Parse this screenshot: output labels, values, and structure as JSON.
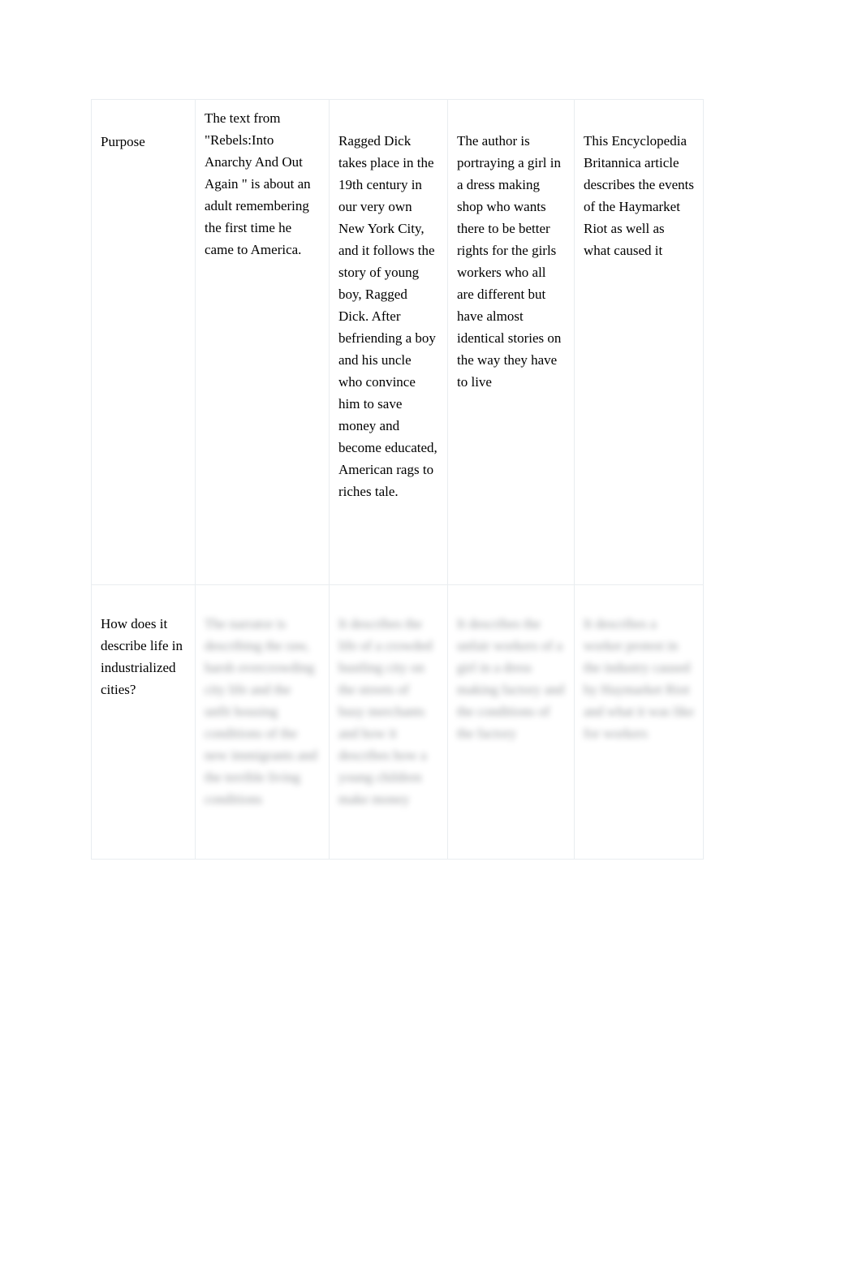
{
  "document": {
    "type": "table",
    "background_color": "#ffffff",
    "border_color": "#e9edf0",
    "text_color": "#000000"
  },
  "table": {
    "columns": 5,
    "rows": 2,
    "row_labels": [
      "Purpose",
      "How does it describe life in industrialized cities?"
    ],
    "rows_data": [
      {
        "label": "Purpose",
        "cells": [
          {
            "source": "column-2",
            "readable": true,
            "text": "The text from \"Rebels:Into Anarchy And Out Again \" is about an adult remembering the first time he came to America."
          },
          {
            "source": "column-3",
            "readable": true,
            "text": "Ragged Dick takes place in the 19th century in our very own New York City, and it follows the story of young boy, Ragged Dick. After befriending a boy and his uncle who convince him to save money and become educated, American rags to riches tale."
          },
          {
            "source": "column-4",
            "readable": true,
            "text": "The author is portraying a girl in a dress making shop who wants there to be better rights for the girls workers who all are different but have almost identical stories on the way they have to live"
          },
          {
            "source": "column-5",
            "readable": true,
            "text": "This Encyclopedia Britannica article describes the events of the Haymarket Riot as well as what caused it"
          }
        ]
      },
      {
        "label": "How does it describe life in industrialized cities?",
        "cells": [
          {
            "source": "column-2",
            "readable": false,
            "redacted": true,
            "text": "The narrator is describing the raw, harsh overcrowding city life and the unfit housing conditions of the new immigrants and the terrible living conditions"
          },
          {
            "source": "column-3",
            "readable": false,
            "redacted": true,
            "text": "It describes the life of a crowded bustling city on the streets of busy merchants and how it describes how a young children make money"
          },
          {
            "source": "column-4",
            "readable": false,
            "redacted": true,
            "text": "It describes the unfair workers of a girl in a dress making factory and the conditions of the factory"
          },
          {
            "source": "column-5",
            "readable": false,
            "redacted": true,
            "text": "It describes a worker protest in the industry caused by Haymarket Riot and what it was like for workers"
          }
        ]
      }
    ]
  }
}
